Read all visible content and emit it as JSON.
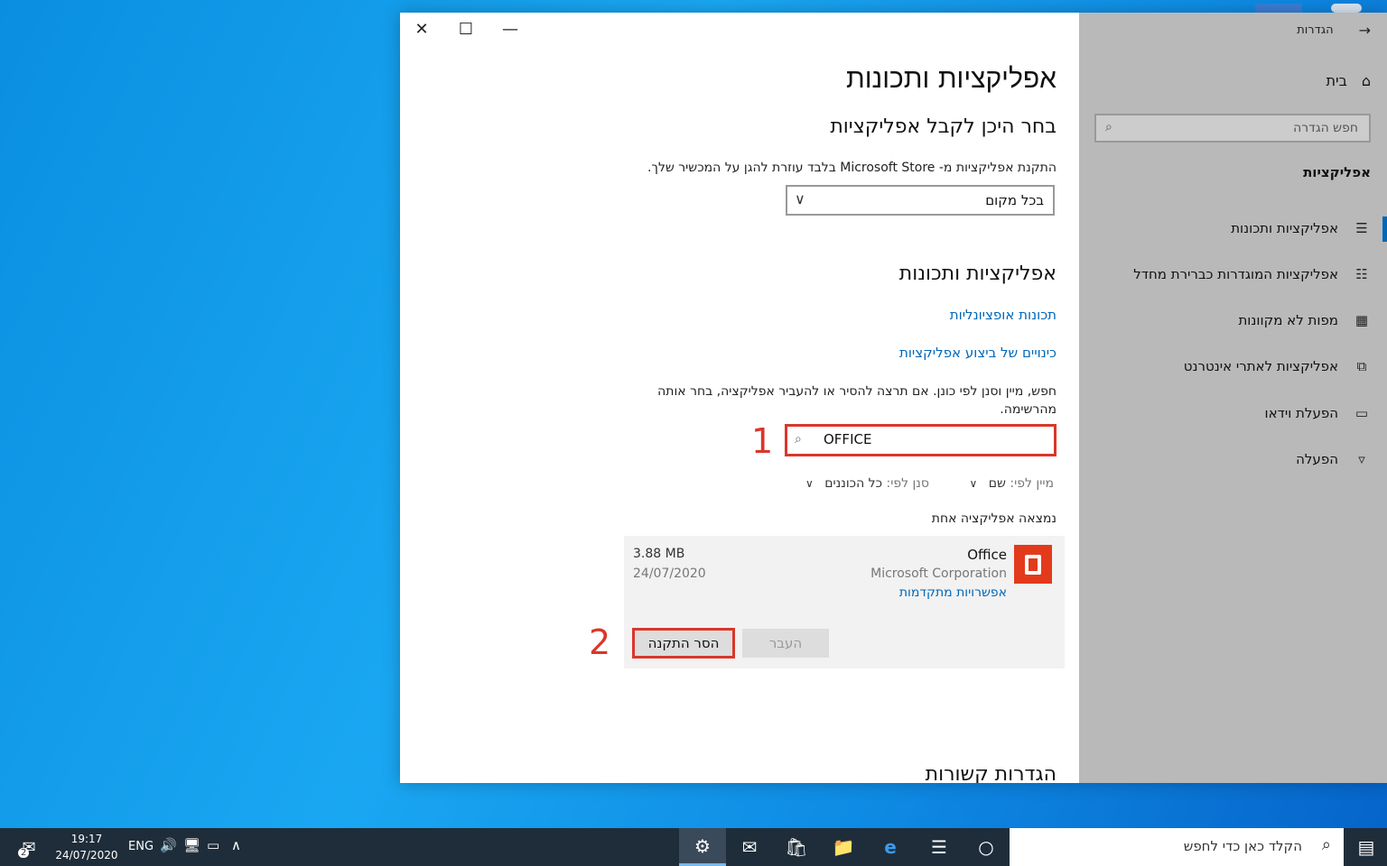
{
  "window": {
    "close": "✕",
    "maximize": "☐",
    "minimize": "—"
  },
  "nav": {
    "back_icon": "arrow-right",
    "settings_label": "הגדרות",
    "home_label": "בית",
    "search_placeholder": "חפש הגדרה",
    "section": "אפליקציות",
    "items": [
      {
        "label": "אפליקציות ותכונות",
        "icon": "apps-list"
      },
      {
        "label": "אפליקציות המוגדרות כברירת מחדל",
        "icon": "default-apps"
      },
      {
        "label": "מפות לא מקוונות",
        "icon": "map"
      },
      {
        "label": "אפליקציות לאתרי אינטרנט",
        "icon": "web-apps"
      },
      {
        "label": "הפעלת וידאו",
        "icon": "video"
      },
      {
        "label": "הפעלה",
        "icon": "startup"
      }
    ]
  },
  "main": {
    "title": "אפליקציות ותכונות",
    "choose_heading": "בחר היכן לקבל אפליקציות",
    "choose_desc": "התקנת אפליקציות מ- Microsoft Store בלבד עוזרת להגן על המכשיר שלך.",
    "choose_value": "בכל מקום",
    "apps_heading": "אפליקציות ותכונות",
    "optional_features_link": "תכונות אופציונליות",
    "aliases_link": "כינויים של ביצוע אפליקציות",
    "search_desc": "חפש, מיין וסנן לפי כונן. אם תרצה להסיר או להעביר אפליקציה, בחר אותה מהרשימה.",
    "search_value": "OFFICE",
    "marker_1": "1",
    "marker_2": "2",
    "sort_label": "מיין לפי:",
    "sort_value": "שם",
    "filter_label": "סנן לפי:",
    "filter_value": "כל הכוננים",
    "found_text": "נמצאה אפליקציה אחת",
    "related_heading": "הגדרות קשורות"
  },
  "app": {
    "name": "Office",
    "publisher": "Microsoft Corporation",
    "advanced_link": "אפשרויות מתקדמות",
    "size": "3.88 MB",
    "date": "24/07/2020",
    "uninstall_label": "הסר התקנה",
    "move_label": "העבר",
    "icon_color": "#e33a1c"
  },
  "taskbar": {
    "search_placeholder": "הקלד כאן כדי לחפש",
    "time": "19:17",
    "date": "24/07/2020",
    "language": "ENG",
    "notification_count": "2"
  },
  "colors": {
    "accent": "#0067b8",
    "highlight": "#d9372b"
  }
}
